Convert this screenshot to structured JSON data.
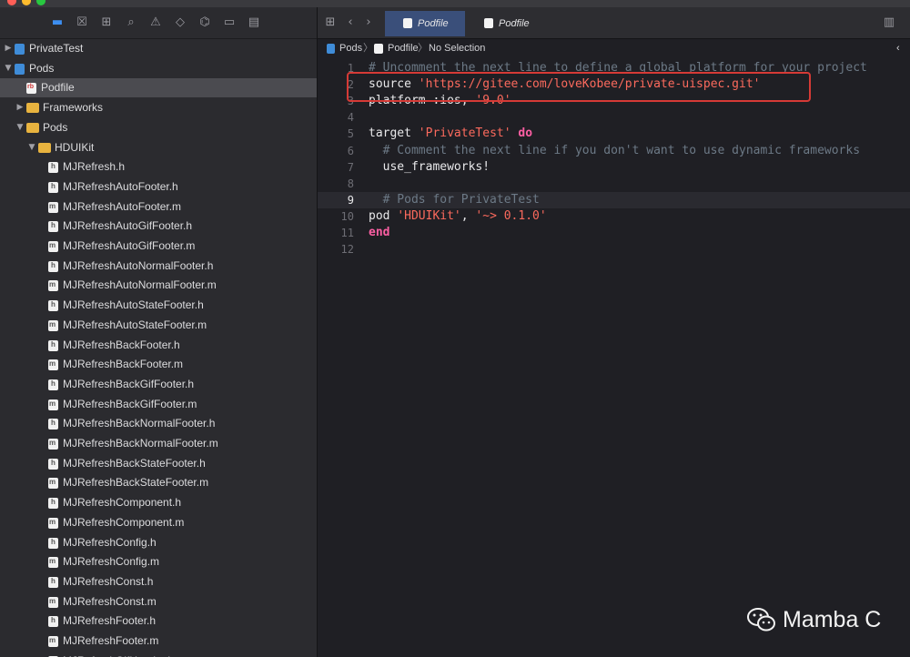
{
  "navigator": {
    "items": [
      {
        "label": "PrivateTest",
        "icon": "proj",
        "indent": 0,
        "disclosure": "right"
      },
      {
        "label": "Pods",
        "icon": "proj",
        "indent": 0,
        "disclosure": "down"
      },
      {
        "label": "Podfile",
        "icon": "rb",
        "indent": 1,
        "disclosure": "",
        "selected": true
      },
      {
        "label": "Frameworks",
        "icon": "folder",
        "indent": 1,
        "disclosure": "right"
      },
      {
        "label": "Pods",
        "icon": "folder",
        "indent": 1,
        "disclosure": "down"
      },
      {
        "label": "HDUIKit",
        "icon": "folder",
        "indent": 2,
        "disclosure": "down"
      },
      {
        "label": "MJRefresh.h",
        "icon": "h",
        "indent": 3
      },
      {
        "label": "MJRefreshAutoFooter.h",
        "icon": "h",
        "indent": 3
      },
      {
        "label": "MJRefreshAutoFooter.m",
        "icon": "m",
        "indent": 3
      },
      {
        "label": "MJRefreshAutoGifFooter.h",
        "icon": "h",
        "indent": 3
      },
      {
        "label": "MJRefreshAutoGifFooter.m",
        "icon": "m",
        "indent": 3
      },
      {
        "label": "MJRefreshAutoNormalFooter.h",
        "icon": "h",
        "indent": 3
      },
      {
        "label": "MJRefreshAutoNormalFooter.m",
        "icon": "m",
        "indent": 3
      },
      {
        "label": "MJRefreshAutoStateFooter.h",
        "icon": "h",
        "indent": 3
      },
      {
        "label": "MJRefreshAutoStateFooter.m",
        "icon": "m",
        "indent": 3
      },
      {
        "label": "MJRefreshBackFooter.h",
        "icon": "h",
        "indent": 3
      },
      {
        "label": "MJRefreshBackFooter.m",
        "icon": "m",
        "indent": 3
      },
      {
        "label": "MJRefreshBackGifFooter.h",
        "icon": "h",
        "indent": 3
      },
      {
        "label": "MJRefreshBackGifFooter.m",
        "icon": "m",
        "indent": 3
      },
      {
        "label": "MJRefreshBackNormalFooter.h",
        "icon": "h",
        "indent": 3
      },
      {
        "label": "MJRefreshBackNormalFooter.m",
        "icon": "m",
        "indent": 3
      },
      {
        "label": "MJRefreshBackStateFooter.h",
        "icon": "h",
        "indent": 3
      },
      {
        "label": "MJRefreshBackStateFooter.m",
        "icon": "m",
        "indent": 3
      },
      {
        "label": "MJRefreshComponent.h",
        "icon": "h",
        "indent": 3
      },
      {
        "label": "MJRefreshComponent.m",
        "icon": "m",
        "indent": 3
      },
      {
        "label": "MJRefreshConfig.h",
        "icon": "h",
        "indent": 3
      },
      {
        "label": "MJRefreshConfig.m",
        "icon": "m",
        "indent": 3
      },
      {
        "label": "MJRefreshConst.h",
        "icon": "h",
        "indent": 3
      },
      {
        "label": "MJRefreshConst.m",
        "icon": "m",
        "indent": 3
      },
      {
        "label": "MJRefreshFooter.h",
        "icon": "h",
        "indent": 3
      },
      {
        "label": "MJRefreshFooter.m",
        "icon": "m",
        "indent": 3
      },
      {
        "label": "MJRefreshGifHeader.h",
        "icon": "h",
        "indent": 3
      }
    ]
  },
  "tabs": [
    {
      "label": "Podfile",
      "active": true
    },
    {
      "label": "Podfile",
      "active": false
    }
  ],
  "jumpbar": {
    "project": "Pods",
    "file": "Podfile",
    "selection": "No Selection"
  },
  "code": {
    "lines": [
      {
        "num": "1",
        "tokens": [
          {
            "t": "cm",
            "v": "# Uncomment the next line to define a global platform for your project"
          }
        ]
      },
      {
        "num": "2",
        "tokens": [
          {
            "t": "pl",
            "v": "source "
          },
          {
            "t": "str",
            "v": "'https://gitee.com/loveKobee/private-uispec.git'"
          }
        ]
      },
      {
        "num": "3",
        "tokens": [
          {
            "t": "pl",
            "v": "platform :ios, "
          },
          {
            "t": "str",
            "v": "'9.0'"
          }
        ]
      },
      {
        "num": "4",
        "tokens": []
      },
      {
        "num": "5",
        "tokens": [
          {
            "t": "pl",
            "v": "target "
          },
          {
            "t": "str",
            "v": "'PrivateTest'"
          },
          {
            "t": "kw",
            "v": " do"
          }
        ]
      },
      {
        "num": "6",
        "tokens": [
          {
            "t": "cm",
            "v": "  # Comment the next line if you don't want to use dynamic frameworks"
          }
        ]
      },
      {
        "num": "7",
        "tokens": [
          {
            "t": "pl",
            "v": "  use_frameworks!"
          }
        ]
      },
      {
        "num": "8",
        "tokens": []
      },
      {
        "num": "9",
        "tokens": [
          {
            "t": "cm",
            "v": "  # Pods for PrivateTest"
          }
        ],
        "current": true
      },
      {
        "num": "10",
        "tokens": [
          {
            "t": "pl",
            "v": "pod "
          },
          {
            "t": "str",
            "v": "'HDUIKit'"
          },
          {
            "t": "pl",
            "v": ", "
          },
          {
            "t": "str",
            "v": "'~> 0.1.0'"
          }
        ]
      },
      {
        "num": "11",
        "tokens": [
          {
            "t": "kw",
            "v": "end"
          }
        ]
      },
      {
        "num": "12",
        "tokens": []
      }
    ]
  },
  "watermark": {
    "text": "Mamba C"
  },
  "colors": {
    "keyword": "#fc5fa3",
    "string": "#fc6a5d",
    "comment": "#6c7986",
    "highlight_box": "#d63a36",
    "folder": "#e8b33f",
    "active_tab": "#3a4f7a"
  }
}
